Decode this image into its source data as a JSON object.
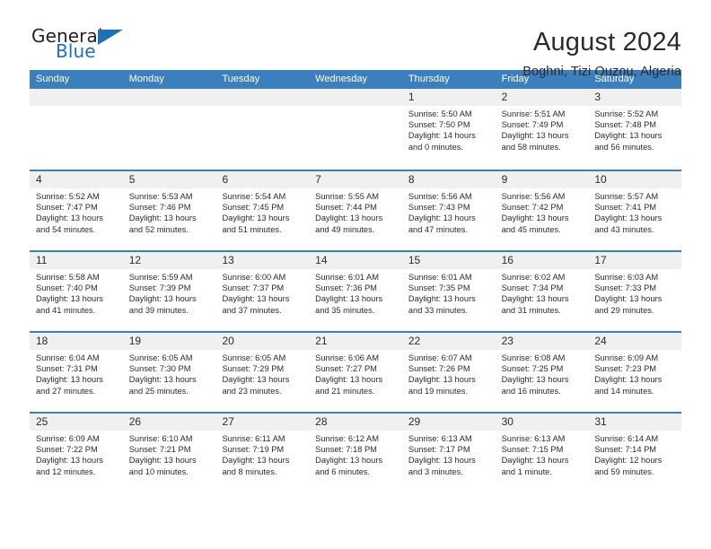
{
  "brand": {
    "name_dark": "General",
    "name_blue": "Blue",
    "accent_color": "#1b72b8"
  },
  "header": {
    "title": "August 2024",
    "subtitle": "Boghni, Tizi Ouzou, Algeria"
  },
  "theme": {
    "header_row_bg": "#3b7fbe",
    "day_band_bg": "#f0f0f0",
    "text_color": "#2b2b2b",
    "cell_bg": "#ffffff"
  },
  "weekdays": [
    "Sunday",
    "Monday",
    "Tuesday",
    "Wednesday",
    "Thursday",
    "Friday",
    "Saturday"
  ],
  "weeks": [
    [
      {
        "day": "",
        "empty": true
      },
      {
        "day": "",
        "empty": true
      },
      {
        "day": "",
        "empty": true
      },
      {
        "day": "",
        "empty": true
      },
      {
        "day": "1",
        "sunrise": "Sunrise: 5:50 AM",
        "sunset": "Sunset: 7:50 PM",
        "daylight": "Daylight: 14 hours and 0 minutes."
      },
      {
        "day": "2",
        "sunrise": "Sunrise: 5:51 AM",
        "sunset": "Sunset: 7:49 PM",
        "daylight": "Daylight: 13 hours and 58 minutes."
      },
      {
        "day": "3",
        "sunrise": "Sunrise: 5:52 AM",
        "sunset": "Sunset: 7:48 PM",
        "daylight": "Daylight: 13 hours and 56 minutes."
      }
    ],
    [
      {
        "day": "4",
        "sunrise": "Sunrise: 5:52 AM",
        "sunset": "Sunset: 7:47 PM",
        "daylight": "Daylight: 13 hours and 54 minutes."
      },
      {
        "day": "5",
        "sunrise": "Sunrise: 5:53 AM",
        "sunset": "Sunset: 7:46 PM",
        "daylight": "Daylight: 13 hours and 52 minutes."
      },
      {
        "day": "6",
        "sunrise": "Sunrise: 5:54 AM",
        "sunset": "Sunset: 7:45 PM",
        "daylight": "Daylight: 13 hours and 51 minutes."
      },
      {
        "day": "7",
        "sunrise": "Sunrise: 5:55 AM",
        "sunset": "Sunset: 7:44 PM",
        "daylight": "Daylight: 13 hours and 49 minutes."
      },
      {
        "day": "8",
        "sunrise": "Sunrise: 5:56 AM",
        "sunset": "Sunset: 7:43 PM",
        "daylight": "Daylight: 13 hours and 47 minutes."
      },
      {
        "day": "9",
        "sunrise": "Sunrise: 5:56 AM",
        "sunset": "Sunset: 7:42 PM",
        "daylight": "Daylight: 13 hours and 45 minutes."
      },
      {
        "day": "10",
        "sunrise": "Sunrise: 5:57 AM",
        "sunset": "Sunset: 7:41 PM",
        "daylight": "Daylight: 13 hours and 43 minutes."
      }
    ],
    [
      {
        "day": "11",
        "sunrise": "Sunrise: 5:58 AM",
        "sunset": "Sunset: 7:40 PM",
        "daylight": "Daylight: 13 hours and 41 minutes."
      },
      {
        "day": "12",
        "sunrise": "Sunrise: 5:59 AM",
        "sunset": "Sunset: 7:39 PM",
        "daylight": "Daylight: 13 hours and 39 minutes."
      },
      {
        "day": "13",
        "sunrise": "Sunrise: 6:00 AM",
        "sunset": "Sunset: 7:37 PM",
        "daylight": "Daylight: 13 hours and 37 minutes."
      },
      {
        "day": "14",
        "sunrise": "Sunrise: 6:01 AM",
        "sunset": "Sunset: 7:36 PM",
        "daylight": "Daylight: 13 hours and 35 minutes."
      },
      {
        "day": "15",
        "sunrise": "Sunrise: 6:01 AM",
        "sunset": "Sunset: 7:35 PM",
        "daylight": "Daylight: 13 hours and 33 minutes."
      },
      {
        "day": "16",
        "sunrise": "Sunrise: 6:02 AM",
        "sunset": "Sunset: 7:34 PM",
        "daylight": "Daylight: 13 hours and 31 minutes."
      },
      {
        "day": "17",
        "sunrise": "Sunrise: 6:03 AM",
        "sunset": "Sunset: 7:33 PM",
        "daylight": "Daylight: 13 hours and 29 minutes."
      }
    ],
    [
      {
        "day": "18",
        "sunrise": "Sunrise: 6:04 AM",
        "sunset": "Sunset: 7:31 PM",
        "daylight": "Daylight: 13 hours and 27 minutes."
      },
      {
        "day": "19",
        "sunrise": "Sunrise: 6:05 AM",
        "sunset": "Sunset: 7:30 PM",
        "daylight": "Daylight: 13 hours and 25 minutes."
      },
      {
        "day": "20",
        "sunrise": "Sunrise: 6:05 AM",
        "sunset": "Sunset: 7:29 PM",
        "daylight": "Daylight: 13 hours and 23 minutes."
      },
      {
        "day": "21",
        "sunrise": "Sunrise: 6:06 AM",
        "sunset": "Sunset: 7:27 PM",
        "daylight": "Daylight: 13 hours and 21 minutes."
      },
      {
        "day": "22",
        "sunrise": "Sunrise: 6:07 AM",
        "sunset": "Sunset: 7:26 PM",
        "daylight": "Daylight: 13 hours and 19 minutes."
      },
      {
        "day": "23",
        "sunrise": "Sunrise: 6:08 AM",
        "sunset": "Sunset: 7:25 PM",
        "daylight": "Daylight: 13 hours and 16 minutes."
      },
      {
        "day": "24",
        "sunrise": "Sunrise: 6:09 AM",
        "sunset": "Sunset: 7:23 PM",
        "daylight": "Daylight: 13 hours and 14 minutes."
      }
    ],
    [
      {
        "day": "25",
        "sunrise": "Sunrise: 6:09 AM",
        "sunset": "Sunset: 7:22 PM",
        "daylight": "Daylight: 13 hours and 12 minutes."
      },
      {
        "day": "26",
        "sunrise": "Sunrise: 6:10 AM",
        "sunset": "Sunset: 7:21 PM",
        "daylight": "Daylight: 13 hours and 10 minutes."
      },
      {
        "day": "27",
        "sunrise": "Sunrise: 6:11 AM",
        "sunset": "Sunset: 7:19 PM",
        "daylight": "Daylight: 13 hours and 8 minutes."
      },
      {
        "day": "28",
        "sunrise": "Sunrise: 6:12 AM",
        "sunset": "Sunset: 7:18 PM",
        "daylight": "Daylight: 13 hours and 6 minutes."
      },
      {
        "day": "29",
        "sunrise": "Sunrise: 6:13 AM",
        "sunset": "Sunset: 7:17 PM",
        "daylight": "Daylight: 13 hours and 3 minutes."
      },
      {
        "day": "30",
        "sunrise": "Sunrise: 6:13 AM",
        "sunset": "Sunset: 7:15 PM",
        "daylight": "Daylight: 13 hours and 1 minute."
      },
      {
        "day": "31",
        "sunrise": "Sunrise: 6:14 AM",
        "sunset": "Sunset: 7:14 PM",
        "daylight": "Daylight: 12 hours and 59 minutes."
      }
    ]
  ]
}
